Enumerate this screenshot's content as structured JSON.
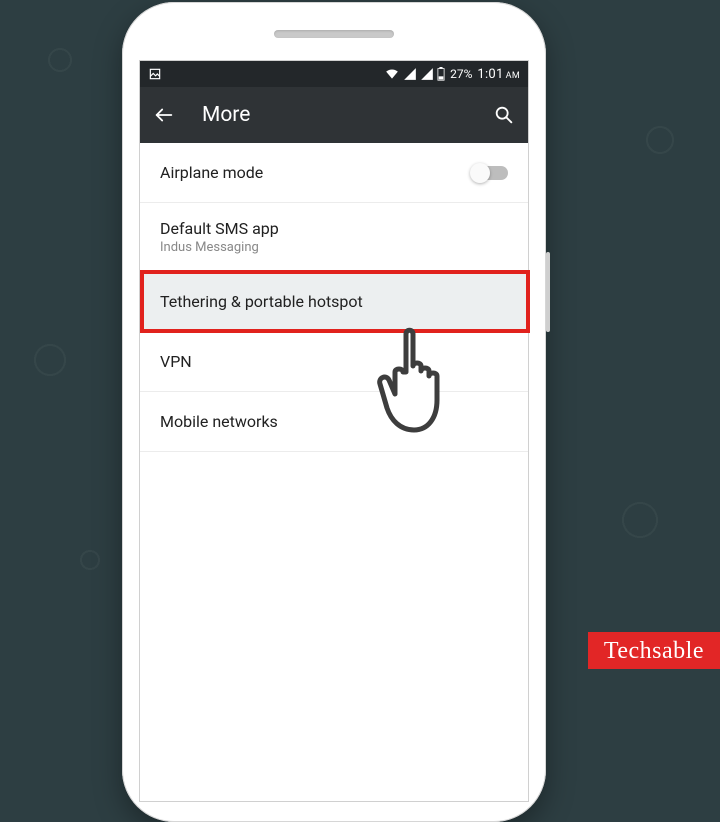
{
  "status": {
    "battery_percent": "27%",
    "time": "1:01",
    "ampm": "AM"
  },
  "appbar": {
    "title": "More"
  },
  "rows": {
    "airplane": {
      "label": "Airplane mode"
    },
    "sms": {
      "label": "Default SMS app",
      "sub": "Indus Messaging"
    },
    "tether": {
      "label": "Tethering & portable hotspot"
    },
    "vpn": {
      "label": "VPN"
    },
    "mobile": {
      "label": "Mobile networks"
    }
  },
  "watermark": "Techsable"
}
